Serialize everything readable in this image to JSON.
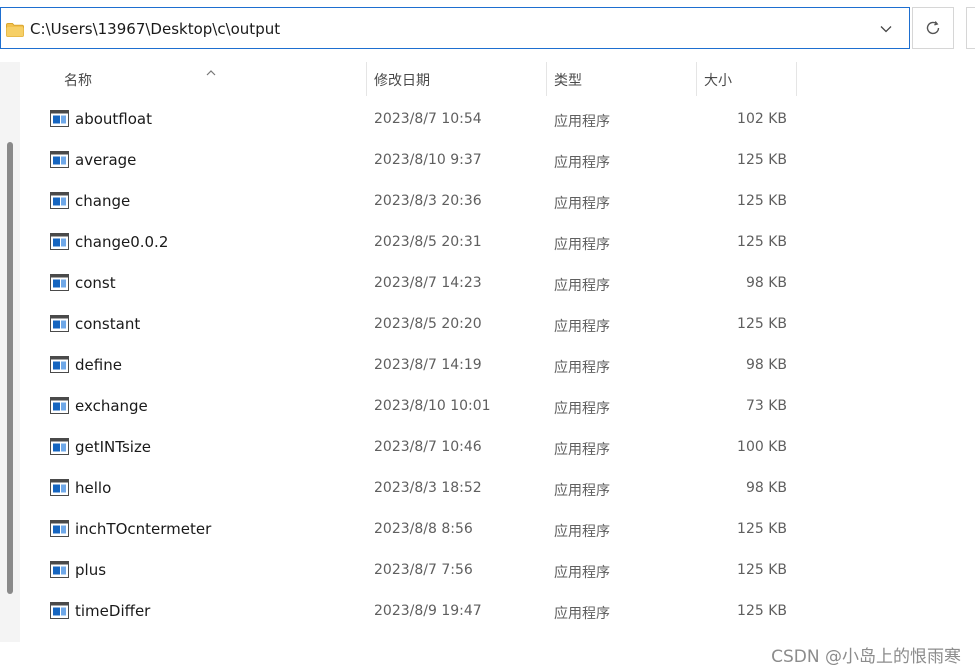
{
  "address_bar": {
    "path": "C:\\Users\\13967\\Desktop\\c\\output",
    "folder_icon": "folder-icon",
    "dropdown_icon": "chevron-down-icon",
    "refresh_icon": "refresh-icon"
  },
  "columns": {
    "name": "名称",
    "date": "修改日期",
    "type": "类型",
    "size": "大小",
    "sort_icon": "sort-ascending-icon"
  },
  "files": [
    {
      "name": "aboutfloat",
      "date": "2023/8/7 10:54",
      "type": "应用程序",
      "size": "102 KB"
    },
    {
      "name": "average",
      "date": "2023/8/10 9:37",
      "type": "应用程序",
      "size": "125 KB"
    },
    {
      "name": "change",
      "date": "2023/8/3 20:36",
      "type": "应用程序",
      "size": "125 KB"
    },
    {
      "name": "change0.0.2",
      "date": "2023/8/5 20:31",
      "type": "应用程序",
      "size": "125 KB"
    },
    {
      "name": "const",
      "date": "2023/8/7 14:23",
      "type": "应用程序",
      "size": "98 KB"
    },
    {
      "name": "constant",
      "date": "2023/8/5 20:20",
      "type": "应用程序",
      "size": "125 KB"
    },
    {
      "name": "define",
      "date": "2023/8/7 14:19",
      "type": "应用程序",
      "size": "98 KB"
    },
    {
      "name": "exchange",
      "date": "2023/8/10 10:01",
      "type": "应用程序",
      "size": "73 KB"
    },
    {
      "name": "getINTsize",
      "date": "2023/8/7 10:46",
      "type": "应用程序",
      "size": "100 KB"
    },
    {
      "name": "hello",
      "date": "2023/8/3 18:52",
      "type": "应用程序",
      "size": "98 KB"
    },
    {
      "name": "inchTOcntermeter",
      "date": "2023/8/8 8:56",
      "type": "应用程序",
      "size": "125 KB"
    },
    {
      "name": "plus",
      "date": "2023/8/7 7:56",
      "type": "应用程序",
      "size": "125 KB"
    },
    {
      "name": "timeDiffer",
      "date": "2023/8/9 19:47",
      "type": "应用程序",
      "size": "125 KB"
    }
  ],
  "file_icon": "application-window-icon",
  "watermark": "CSDN @小岛上的恨雨寒",
  "colors": {
    "accent": "#1e6fd0",
    "folder": "#f2c14e",
    "app_icon_blue": "#1565c0"
  }
}
